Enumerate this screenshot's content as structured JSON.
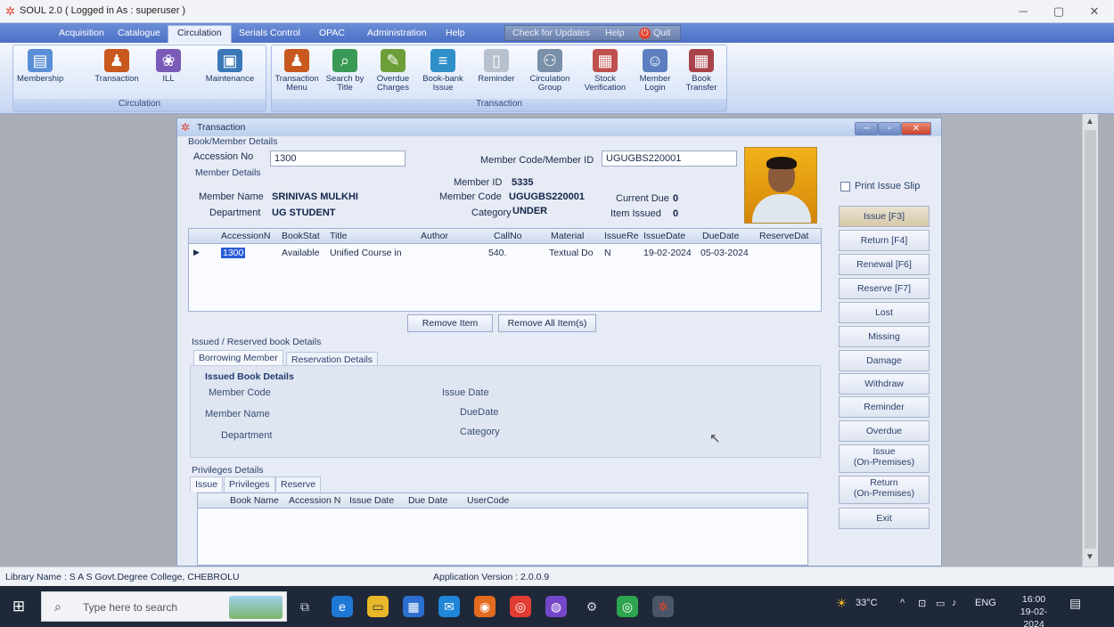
{
  "window": {
    "title": "SOUL 2.0  ( Logged in As : superuser )",
    "min": "─",
    "max": "▢",
    "close": "✕"
  },
  "menu": {
    "tabs": [
      "Acquisition",
      "Catalogue",
      "Circulation",
      "Serials Control",
      "OPAC",
      "Administration",
      "Help"
    ],
    "check_updates": "Check for Updates",
    "help": "Help",
    "quit": "Quit"
  },
  "ribbon": {
    "circulation_group": "Circulation",
    "transaction_group": "Transaction",
    "buttons": [
      {
        "label": "Membership",
        "icon": "membership-icon",
        "color": "#5b8fd6",
        "glyph": "▤"
      },
      {
        "label": "Transaction",
        "icon": "transaction-icon",
        "color": "#c8581e",
        "glyph": "♟"
      },
      {
        "label": "ILL",
        "icon": "ill-icon",
        "color": "#7a5bb8",
        "glyph": "❀"
      },
      {
        "label": "Maintenance",
        "icon": "maintenance-icon",
        "color": "#3b78b8",
        "glyph": "▣"
      },
      {
        "label": "Transaction Menu",
        "icon": "transaction-menu-icon",
        "color": "#c8581e",
        "glyph": "♟"
      },
      {
        "label": "Search by Title",
        "icon": "search-title-icon",
        "color": "#3a9a55",
        "glyph": "⌕"
      },
      {
        "label": "Overdue Charges",
        "icon": "overdue-icon",
        "color": "#6d9e3a",
        "glyph": "✎"
      },
      {
        "label": "Book-bank Issue",
        "icon": "bookbank-icon",
        "color": "#2f8fc7",
        "glyph": "≡"
      },
      {
        "label": "Reminder",
        "icon": "reminder-icon",
        "color": "#b8c1cf",
        "glyph": "▯"
      },
      {
        "label": "Circulation Group",
        "icon": "circ-group-icon",
        "color": "#7a8fa8",
        "glyph": "⚇"
      },
      {
        "label": "Stock Verification",
        "icon": "stock-icon",
        "color": "#c0504d",
        "glyph": "▦"
      },
      {
        "label": "Member Login",
        "icon": "member-login-icon",
        "color": "#5d7fc0",
        "glyph": "☺"
      },
      {
        "label": "Book Transfer",
        "icon": "book-transfer-icon",
        "color": "#a8434a",
        "glyph": "▦"
      }
    ]
  },
  "transaction": {
    "title": "Transaction",
    "book_member_details": "Book/Member Details",
    "accession_label": "Accession No",
    "accession_value": "1300",
    "member_code_label": "Member Code/Member ID",
    "member_code_value": "UGUGBS220001",
    "member_details": "Member Details",
    "member_id_label": "Member ID",
    "member_id_value": "5335",
    "member_name_label": "Member Name",
    "member_name_value": "SRINIVAS MULKHI",
    "member_code2_label": "Member Code",
    "member_code2_value": "UGUGBS220001",
    "current_due_label": "Current Due",
    "current_due_value": "0",
    "department_label": "Department",
    "department_value": "UG STUDENT",
    "category_label": "Category",
    "category_value": "UNDER",
    "item_issued_label": "Item Issued",
    "item_issued_value": "0",
    "grid_columns": [
      "AccessionN",
      "BookStat",
      "Title",
      "Author",
      "CallNo",
      "Material",
      "IssueRe",
      "IssueDate",
      "DueDate",
      "ReserveDat"
    ],
    "grid_rows": [
      {
        "accession": "1300",
        "status": "Available",
        "title": "Unified Course in",
        "author": "",
        "callno": "540.",
        "material": "Textual Do",
        "issue_re": "N",
        "issue_date": "19-02-2024",
        "due_date": "05-03-2024",
        "reserve": ""
      }
    ],
    "remove_item": "Remove Item",
    "remove_all": "Remove All Item(s)",
    "issued_reserved": "Issued / Reserved book Details",
    "tab_borrowing": "Borrowing Member",
    "tab_reservation": "Reservation Details",
    "issued_book_details": "Issued Book Details",
    "ib_member_code": "Member Code",
    "ib_member_name": "Member Name",
    "ib_department": "Department",
    "ib_issue_date": "Issue Date",
    "ib_due_date": "DueDate",
    "ib_category": "Category",
    "privileges_details": "Privileges Details",
    "priv_tabs": [
      "Issue",
      "Privileges",
      "Reserve"
    ],
    "priv_columns": [
      "Book Name",
      "Accession N",
      "Issue Date",
      "Due Date",
      "UserCode"
    ],
    "print_issue_slip": "Print Issue Slip",
    "side_buttons": [
      "Issue [F3]",
      "Return [F4]",
      "Renewal [F6]",
      "Reserve [F7]",
      "Lost",
      "Missing",
      "Damage",
      "Withdraw",
      "Reminder",
      "Overdue"
    ],
    "issue_on_premises_1": "Issue",
    "issue_on_premises_2": "(On-Premises)",
    "return_on_premises_1": "Return",
    "return_on_premises_2": "(On-Premises)",
    "exit": "Exit"
  },
  "status": {
    "library_name": "Library Name :  S A S Govt.Degree College, CHEBROLU",
    "version": "Application Version :  2.0.0.9"
  },
  "taskbar": {
    "search_placeholder": "Type here to search",
    "temperature": "33°C",
    "lang": "ENG",
    "time": "16:00",
    "date": "19-02-2024"
  }
}
